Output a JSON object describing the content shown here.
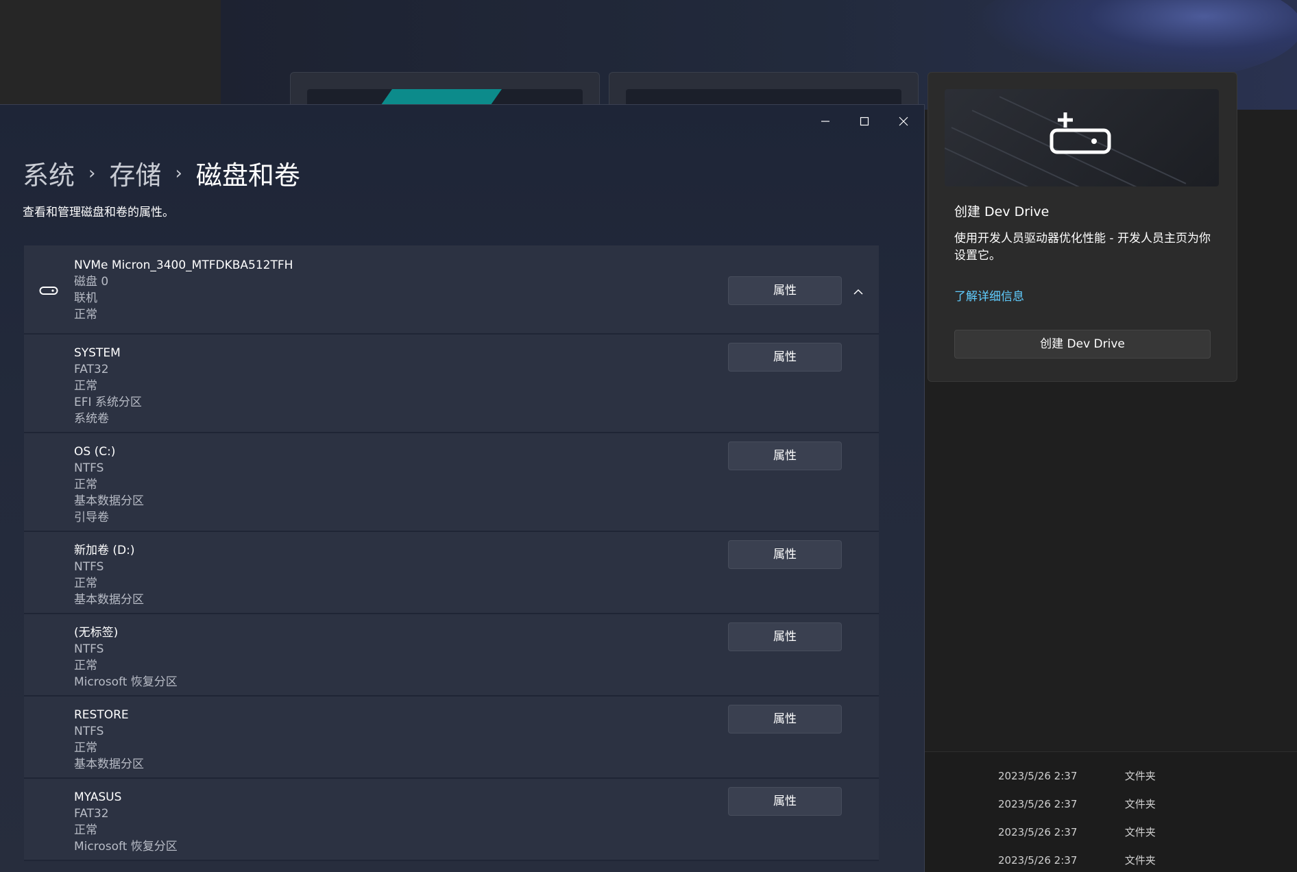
{
  "window": {
    "breadcrumb": [
      "系统",
      "存储",
      "磁盘和卷"
    ],
    "separator": "›",
    "description": "查看和管理磁盘和卷的属性。"
  },
  "disk": {
    "name": "NVMe Micron_3400_MTFDKBA512TFH",
    "details": [
      "磁盘 0",
      "联机",
      "正常"
    ],
    "button": "属性"
  },
  "volumes": [
    {
      "name": "SYSTEM",
      "details": [
        "FAT32",
        "正常",
        "EFI 系统分区",
        "系统卷"
      ],
      "button": "属性"
    },
    {
      "name": "OS (C:)",
      "details": [
        "NTFS",
        "正常",
        "基本数据分区",
        "引导卷"
      ],
      "button": "属性"
    },
    {
      "name": "新加卷 (D:)",
      "details": [
        "NTFS",
        "正常",
        "基本数据分区"
      ],
      "button": "属性"
    },
    {
      "name": "(无标签)",
      "details": [
        "NTFS",
        "正常",
        "Microsoft 恢复分区"
      ],
      "button": "属性"
    },
    {
      "name": "RESTORE",
      "details": [
        "NTFS",
        "正常",
        "基本数据分区"
      ],
      "button": "属性"
    },
    {
      "name": "MYASUS",
      "details": [
        "FAT32",
        "正常",
        "Microsoft 恢复分区"
      ],
      "button": "属性"
    }
  ],
  "dev_drive": {
    "title": "创建 Dev Drive",
    "description": "使用开发人员驱动器优化性能 - 开发人员主页为你设置它。",
    "link": "了解详细信息",
    "button": "创建 Dev Drive"
  },
  "explorer_rows": [
    {
      "date": "2023/5/26 2:37",
      "type": "文件夹"
    },
    {
      "date": "2023/5/26 2:37",
      "type": "文件夹"
    },
    {
      "date": "2023/5/26 2:37",
      "type": "文件夹"
    },
    {
      "date": "2023/5/26 2:37",
      "type": "文件夹"
    }
  ],
  "icons": [
    "minimize-icon",
    "maximize-icon",
    "close-icon",
    "disk-icon",
    "chevron-up-icon",
    "dev-drive-icon"
  ]
}
